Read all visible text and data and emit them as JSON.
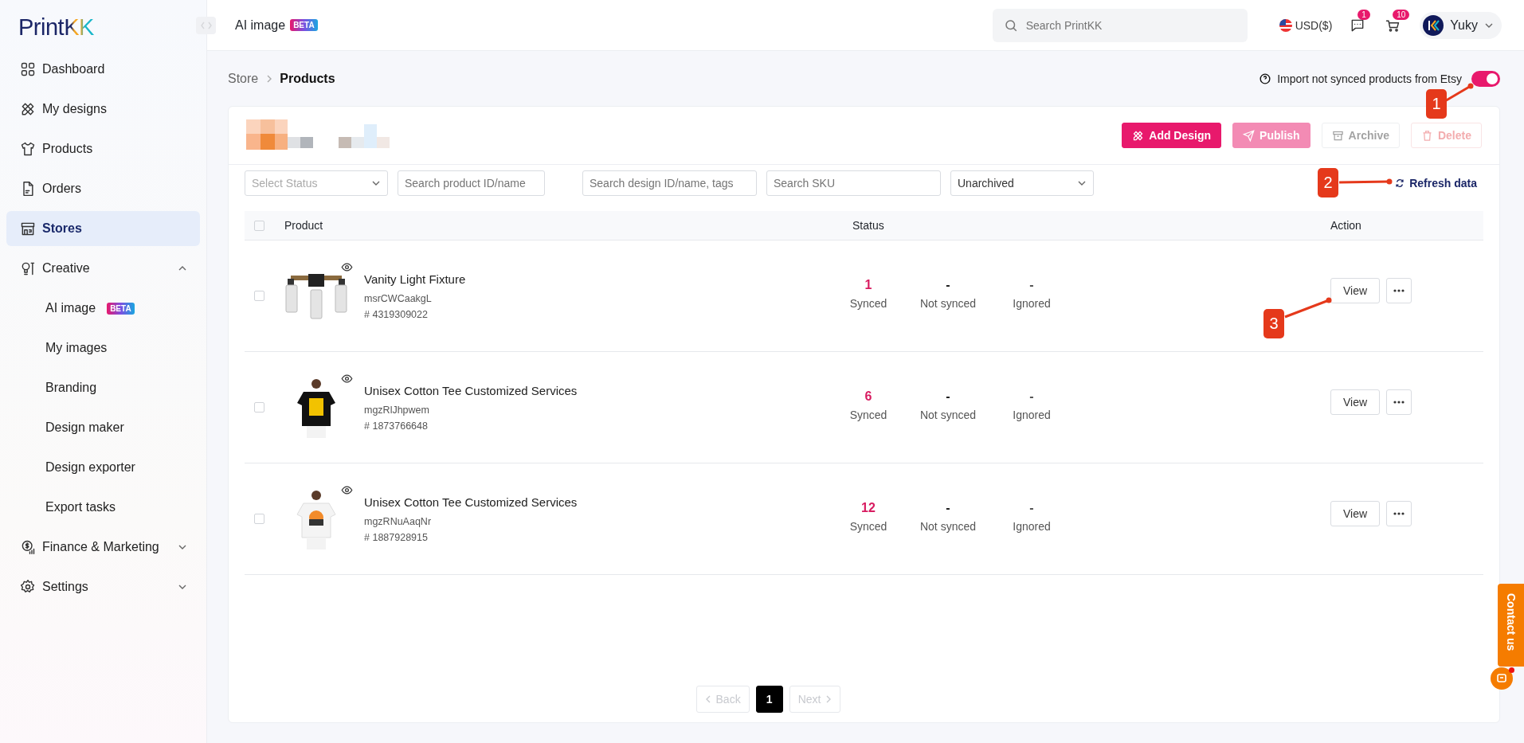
{
  "logo": {
    "name": "Print",
    "mark": "KK"
  },
  "sidebar": {
    "items": [
      {
        "label": "Dashboard",
        "kind": "item",
        "selected": false
      },
      {
        "label": "My designs",
        "kind": "item",
        "selected": false
      },
      {
        "label": "Products",
        "kind": "item",
        "selected": false
      },
      {
        "label": "Orders",
        "kind": "item",
        "selected": false
      },
      {
        "label": "Stores",
        "kind": "item",
        "selected": true
      },
      {
        "label": "Creative",
        "kind": "group",
        "selected": false,
        "expanded": true,
        "children": [
          {
            "label": "AI image",
            "badge": "BETA",
            "selected": false
          },
          {
            "label": "My images",
            "selected": false
          },
          {
            "label": "Branding",
            "selected": false
          },
          {
            "label": "Design maker",
            "selected": false
          },
          {
            "label": "Design exporter",
            "selected": false
          },
          {
            "label": "Export tasks",
            "selected": false
          }
        ]
      },
      {
        "label": "Finance & Marketing",
        "kind": "group",
        "selected": false,
        "expanded": false
      },
      {
        "label": "Settings",
        "kind": "group",
        "selected": false,
        "expanded": false
      }
    ]
  },
  "topbar": {
    "title": "AI image",
    "badge": "BETA",
    "search": {
      "placeholder": "Search PrintKK"
    },
    "currency": "USD($)",
    "messages_badge": "1",
    "cart_badge": "10",
    "user": "Yuky"
  },
  "breadcrumb": [
    {
      "label": "Store",
      "selected": false
    },
    {
      "label": "Products",
      "selected": true
    }
  ],
  "import_toggle": {
    "label": "Import not synced products from Etsy",
    "on": true
  },
  "actions": [
    {
      "label": "Add Design",
      "kind": "primary",
      "disabled": false
    },
    {
      "label": "Publish",
      "kind": "primary",
      "disabled": true
    },
    {
      "label": "Archive",
      "kind": "outline",
      "disabled": true
    },
    {
      "label": "Delete",
      "kind": "danger",
      "disabled": true
    }
  ],
  "filters": [
    {
      "kind": "select",
      "placeholder": "Select Status"
    },
    {
      "kind": "input",
      "placeholder": "Search product ID/name"
    },
    {
      "kind": "input",
      "placeholder": "Search design ID/name, tags"
    },
    {
      "kind": "input",
      "placeholder": "Search SKU"
    },
    {
      "kind": "select",
      "value": "Unarchived"
    }
  ],
  "refresh": {
    "label": "Refresh data"
  },
  "table": {
    "columns": [
      "Product",
      "Status",
      "Action"
    ],
    "header_checked": false,
    "rows": [
      {
        "checked": false,
        "name": "Vanity Light Fixture",
        "handle": "msrCWCaakgL",
        "id": "# 4319309022",
        "stats": [
          {
            "kind": "synced",
            "value": "1",
            "label": "Synced"
          },
          {
            "kind": "not_synced",
            "value": "-",
            "label": "Not synced"
          },
          {
            "kind": "ignored",
            "value": "-",
            "label": "Ignored"
          }
        ],
        "view": "View"
      },
      {
        "checked": false,
        "name": "Unisex Cotton Tee Customized Services",
        "handle": "mgzRlJhpwem",
        "id": "# 1873766648",
        "stats": [
          {
            "kind": "synced",
            "value": "6",
            "label": "Synced"
          },
          {
            "kind": "not_synced",
            "value": "-",
            "label": "Not synced"
          },
          {
            "kind": "ignored",
            "value": "-",
            "label": "Ignored"
          }
        ],
        "view": "View"
      },
      {
        "checked": false,
        "name": "Unisex Cotton Tee Customized Services",
        "handle": "mgzRNuAaqNr",
        "id": "# 1887928915",
        "stats": [
          {
            "kind": "synced",
            "value": "12",
            "label": "Synced"
          },
          {
            "kind": "not_synced",
            "value": "-",
            "label": "Not synced"
          },
          {
            "kind": "ignored",
            "value": "-",
            "label": "Ignored"
          }
        ],
        "view": "View"
      }
    ]
  },
  "pagination": {
    "back": {
      "label": "Back",
      "disabled": true
    },
    "pages": [
      {
        "label": "1",
        "selected": true
      }
    ],
    "next": {
      "label": "Next",
      "disabled": true
    }
  },
  "contact": {
    "label": "Contact us"
  },
  "annotations": [
    {
      "label": "1"
    },
    {
      "label": "2"
    },
    {
      "label": "3"
    }
  ]
}
